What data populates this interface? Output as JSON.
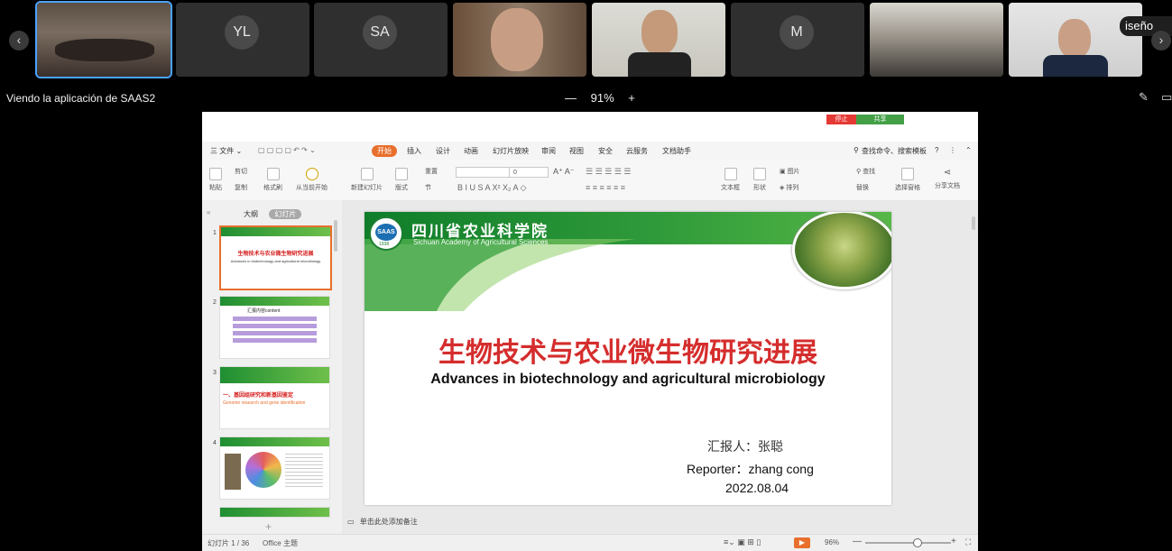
{
  "participants": [
    {
      "initials": "",
      "type": "video-meeting-room",
      "active": true
    },
    {
      "initials": "YL",
      "type": "avatar"
    },
    {
      "initials": "SA",
      "type": "avatar"
    },
    {
      "initials": "",
      "type": "video-person"
    },
    {
      "initials": "",
      "type": "video-person"
    },
    {
      "initials": "M",
      "type": "avatar"
    },
    {
      "initials": "",
      "type": "video-meeting-room"
    },
    {
      "initials": "",
      "type": "video-person"
    }
  ],
  "strip_edge_label": "iseño",
  "viewing_text": "Viendo la aplicación de SAAS2",
  "zoom": {
    "minus": "—",
    "value": "91%",
    "plus": "+"
  },
  "share_controls": {
    "stop": "停止",
    "share": "共享"
  },
  "menubar": {
    "file": "三 文件 ⌄",
    "tabs": [
      "开始",
      "插入",
      "设计",
      "动画",
      "幻灯片放映",
      "审阅",
      "视图",
      "安全",
      "云服务",
      "文档助手"
    ],
    "active_tab": "开始",
    "search": "查找命令、搜索模板"
  },
  "ribbon": {
    "paste": "粘贴",
    "cut": "剪切",
    "copy": "复制",
    "format_painter": "格式刷",
    "from_current": "从当前开始",
    "new_slide": "新建幻灯片",
    "layout": "版式",
    "reset": "重置",
    "section": "节",
    "font_name": "",
    "font_size": "0",
    "textbox": "文本框",
    "shape": "形状",
    "picture": "图片",
    "arrange": "排列",
    "find": "查找",
    "replace": "替换",
    "select_pane": "选择窗格",
    "share_doc": "分享文档"
  },
  "pane": {
    "tab_outline": "大纲",
    "tab_slides": "幻灯片",
    "thumbs": [
      {
        "num": "1",
        "title": "生物技术与农业微生物研究进展",
        "sub": "Advances in biotechnology and agricultural microbiology"
      },
      {
        "num": "2",
        "title": "汇报内容content",
        "sub": ""
      },
      {
        "num": "3",
        "title": "一、基因组研究和新基因鉴定",
        "sub": "Genome research and gene identification"
      },
      {
        "num": "4",
        "title": "",
        "sub": ""
      }
    ]
  },
  "slide": {
    "institute_cn": "四川省农业科学院",
    "institute_en": "Sichuan Academy of Agricultural Sciences",
    "logo_text": "SAAS",
    "logo_year": "1938",
    "title_cn": "生物技术与农业微生物研究进展",
    "title_en": "Advances in biotechnology and agricultural microbiology",
    "reporter_cn": "汇报人：张聪",
    "reporter_en": "Reporter：zhang cong",
    "date": "2022.08.04"
  },
  "notes_placeholder": "单击此处添加备注",
  "statusbar": {
    "slide_counter": "幻灯片 1 / 36",
    "theme": "Office 主题",
    "zoom": "96%",
    "zoom_slider": 0.6
  }
}
